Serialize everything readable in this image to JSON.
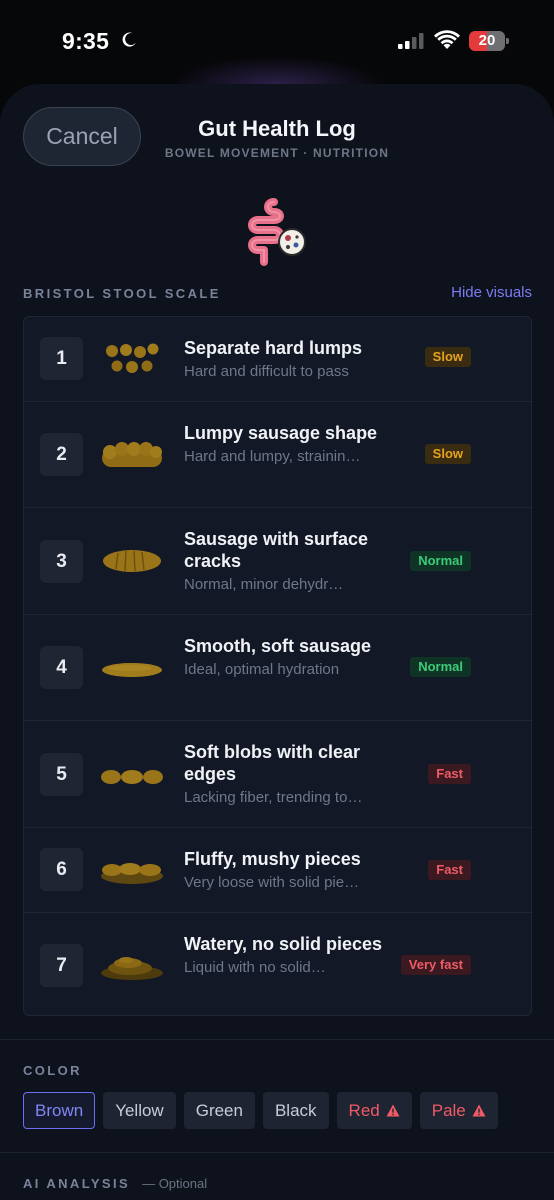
{
  "status": {
    "time": "9:35",
    "battery": "20"
  },
  "header": {
    "cancel_label": "Cancel",
    "title": "Gut Health Log",
    "subtitle": "BOWEL MOVEMENT · NUTRITION"
  },
  "bristol": {
    "section_label": "BRISTOL STOOL SCALE",
    "toggle_label": "Hide visuals",
    "items": [
      {
        "num": "1",
        "title": "Separate hard lumps",
        "desc": "Hard and difficult to pass",
        "badge": "Slow",
        "badge_kind": "slow"
      },
      {
        "num": "2",
        "title": "Lumpy sausage shape",
        "desc": "Hard and lumpy, strainin…",
        "badge": "Slow",
        "badge_kind": "slow"
      },
      {
        "num": "3",
        "title": "Sausage with surface cracks",
        "desc": "Normal, minor dehydr…",
        "badge": "Normal",
        "badge_kind": "normal"
      },
      {
        "num": "4",
        "title": "Smooth, soft sausage",
        "desc": "Ideal, optimal hydration",
        "badge": "Normal",
        "badge_kind": "normal"
      },
      {
        "num": "5",
        "title": "Soft blobs with clear edges",
        "desc": "Lacking fiber, trending to…",
        "badge": "Fast",
        "badge_kind": "fast"
      },
      {
        "num": "6",
        "title": "Fluffy, mushy pieces",
        "desc": "Very loose with solid pie…",
        "badge": "Fast",
        "badge_kind": "fast"
      },
      {
        "num": "7",
        "title": "Watery, no solid pieces",
        "desc": "Liquid with no solid…",
        "badge": "Very fast",
        "badge_kind": "fast"
      }
    ]
  },
  "color": {
    "section_label": "COLOR",
    "selected": "Brown",
    "options": [
      "Brown",
      "Yellow",
      "Green",
      "Black",
      "Red",
      "Pale"
    ]
  },
  "ai": {
    "section_label": "AI ANALYSIS",
    "optional": "— Optional"
  },
  "colors": {
    "accent": "#6a6ef0",
    "slow": "#e8a21e",
    "normal": "#3dcc79",
    "fast": "#ef5a66"
  }
}
